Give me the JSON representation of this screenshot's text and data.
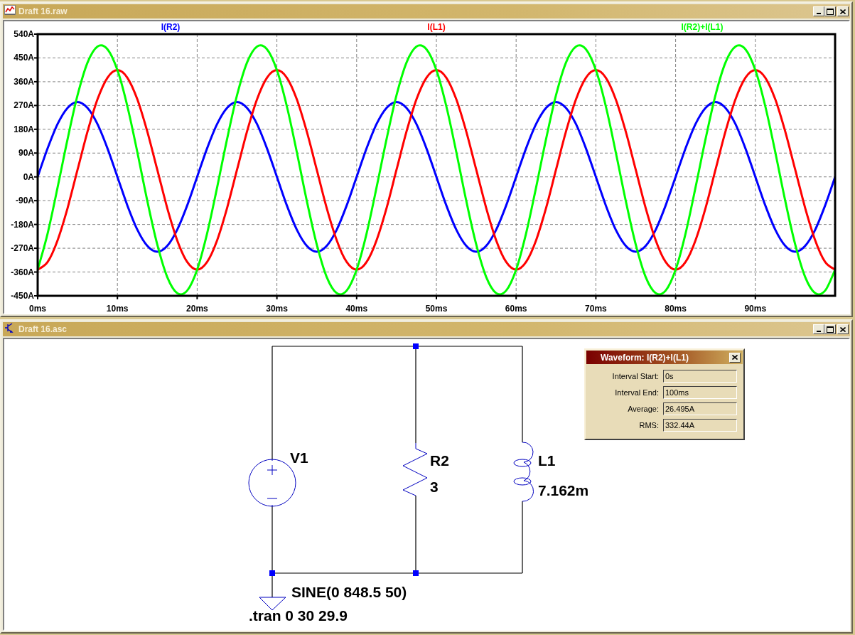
{
  "waveform_window": {
    "title": "Draft 16.raw",
    "chart_data": {
      "type": "line",
      "grid": true,
      "x": [
        0,
        1.25,
        2.5,
        3.75,
        5,
        6.25,
        7.5,
        8.75,
        10,
        11.25,
        12.5,
        13.75,
        15,
        16.25,
        17.5,
        18.75,
        20,
        21.25,
        22.5,
        23.75,
        25,
        26.25,
        27.5,
        28.75,
        30,
        31.25,
        32.5,
        33.75,
        35,
        36.25,
        37.5,
        38.75,
        40,
        41.25,
        42.5,
        43.75,
        45,
        46.25,
        47.5,
        48.75,
        50,
        51.25,
        52.5,
        53.75,
        55,
        56.25,
        57.5,
        58.75,
        60,
        61.25,
        62.5,
        63.75,
        65,
        66.25,
        67.5,
        68.75,
        70,
        71.25,
        72.5,
        73.75,
        75,
        76.25,
        77.5,
        78.75,
        80,
        81.25,
        82.5,
        83.75,
        85,
        86.25,
        87.5,
        88.75,
        90,
        91.25,
        92.5,
        93.75,
        95,
        96.25,
        97.5,
        98.75,
        100
      ],
      "series": [
        {
          "name": "I(R2)",
          "color": "#0000ff",
          "values": [
            0,
            108,
            200,
            261,
            283,
            261,
            200,
            108,
            0,
            -108,
            -200,
            -261,
            -283,
            -261,
            -200,
            -108,
            0,
            108,
            200,
            261,
            283,
            261,
            200,
            108,
            0,
            -108,
            -200,
            -261,
            -283,
            -261,
            -200,
            -108,
            0,
            108,
            200,
            261,
            283,
            261,
            200,
            108,
            0,
            -108,
            -200,
            -261,
            -283,
            -261,
            -200,
            -108,
            0,
            108,
            200,
            261,
            283,
            261,
            200,
            108,
            0,
            -108,
            -200,
            -261,
            -283,
            -261,
            -200,
            -108,
            0,
            108,
            200,
            261,
            283,
            261,
            200,
            108,
            0,
            -108,
            -200,
            -261,
            -283,
            -261,
            -200,
            -108,
            0
          ]
        },
        {
          "name": "I(L1)",
          "color": "#ff0000",
          "values": [
            -351,
            -322,
            -240,
            -118,
            27,
            171,
            293,
            375,
            404,
            375,
            293,
            171,
            27,
            -118,
            -240,
            -322,
            -351,
            -322,
            -240,
            -118,
            27,
            171,
            293,
            375,
            404,
            375,
            293,
            171,
            27,
            -118,
            -240,
            -322,
            -351,
            -322,
            -240,
            -118,
            27,
            171,
            293,
            375,
            404,
            375,
            293,
            171,
            27,
            -118,
            -240,
            -322,
            -351,
            -322,
            -240,
            -118,
            27,
            171,
            293,
            375,
            404,
            375,
            293,
            171,
            27,
            -118,
            -240,
            -322,
            -351,
            -322,
            -240,
            -118,
            27,
            171,
            293,
            375,
            404,
            375,
            293,
            171,
            27,
            -118,
            -240,
            -322,
            -351
          ]
        },
        {
          "name": "I(R2)+I(L1)",
          "color": "#00ff00",
          "values": [
            -351,
            -214,
            -40,
            143,
            309,
            432,
            493,
            483,
            404,
            267,
            93,
            -91,
            -256,
            -379,
            -440,
            -430,
            -351,
            -214,
            -40,
            143,
            309,
            432,
            493,
            483,
            404,
            267,
            93,
            -91,
            -256,
            -379,
            -440,
            -430,
            -351,
            -214,
            -40,
            143,
            309,
            432,
            493,
            483,
            404,
            267,
            93,
            -91,
            -256,
            -379,
            -440,
            -430,
            -351,
            -214,
            -40,
            143,
            309,
            432,
            493,
            483,
            404,
            267,
            93,
            -91,
            -256,
            -379,
            -440,
            -430,
            -351,
            -214,
            -40,
            143,
            309,
            432,
            493,
            483,
            404,
            267,
            93,
            -91,
            -256,
            -379,
            -440,
            -430,
            -351
          ]
        }
      ],
      "xlim": [
        0,
        100
      ],
      "ylim": [
        -450,
        540
      ],
      "xticks": [
        {
          "value": 0,
          "label": "0ms"
        },
        {
          "value": 10,
          "label": "10ms"
        },
        {
          "value": 20,
          "label": "20ms"
        },
        {
          "value": 30,
          "label": "30ms"
        },
        {
          "value": 40,
          "label": "40ms"
        },
        {
          "value": 50,
          "label": "50ms"
        },
        {
          "value": 60,
          "label": "60ms"
        },
        {
          "value": 70,
          "label": "70ms"
        },
        {
          "value": 80,
          "label": "80ms"
        },
        {
          "value": 90,
          "label": "90ms"
        }
      ],
      "yticks": [
        {
          "value": 540,
          "label": "540A"
        },
        {
          "value": 450,
          "label": "450A"
        },
        {
          "value": 360,
          "label": "360A"
        },
        {
          "value": 270,
          "label": "270A"
        },
        {
          "value": 180,
          "label": "180A"
        },
        {
          "value": 90,
          "label": "90A"
        },
        {
          "value": 0,
          "label": "0A"
        },
        {
          "value": -90,
          "label": "-90A"
        },
        {
          "value": -180,
          "label": "-180A"
        },
        {
          "value": -270,
          "label": "-270A"
        },
        {
          "value": -360,
          "label": "-360A"
        },
        {
          "value": -450,
          "label": "-450A"
        }
      ]
    }
  },
  "schematic_window": {
    "title": "Draft 16.asc",
    "components": [
      {
        "kind": "voltage_source",
        "name": "V1",
        "value": "SINE(0 848.5 50)"
      },
      {
        "kind": "resistor",
        "name": "R2",
        "value": "3"
      },
      {
        "kind": "inductor",
        "name": "L1",
        "value": "7.162m"
      }
    ],
    "directive": ".tran 0 30 29.9"
  },
  "waveform_dialog": {
    "title": "Waveform: I(R2)+I(L1)",
    "fields": [
      {
        "label": "Interval Start:",
        "value": "0s"
      },
      {
        "label": "Interval End:",
        "value": "100ms"
      },
      {
        "label": "Average:",
        "value": "26.495A"
      },
      {
        "label": "RMS:",
        "value": "332.44A"
      }
    ]
  }
}
